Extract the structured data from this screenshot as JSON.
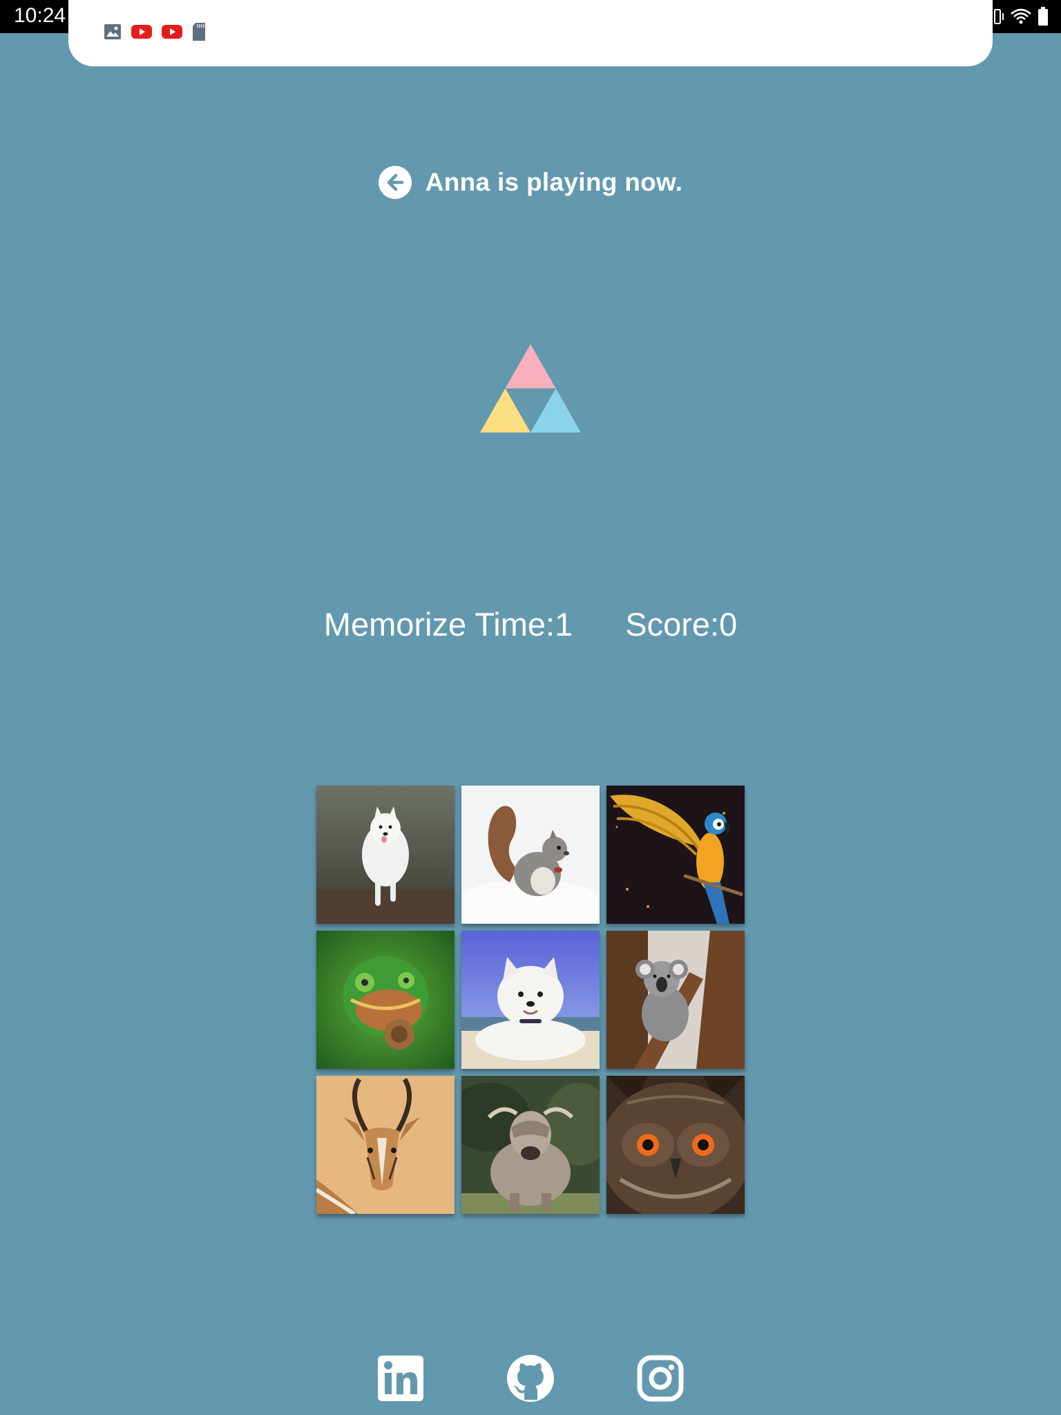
{
  "status_bar": {
    "time": "10:24",
    "icons": [
      "image-icon",
      "youtube-icon",
      "youtube-icon",
      "sd-card-icon",
      "vibrate-icon",
      "wifi-icon",
      "battery-icon"
    ]
  },
  "header": {
    "back_icon": "arrow-left-circle-icon",
    "title": "Anna is playing now."
  },
  "logo": {
    "colors": {
      "top": "#f7b0bc",
      "left": "#fbde82",
      "right": "#8bd3ea"
    }
  },
  "stats": {
    "memorize_label": "Memorize Time:",
    "memorize_value": "1",
    "score_label": "Score:",
    "score_value": "0"
  },
  "grid": {
    "tiles": [
      {
        "subject": "white dog running"
      },
      {
        "subject": "squirrel in snow"
      },
      {
        "subject": "macaw parrot"
      },
      {
        "subject": "chameleon"
      },
      {
        "subject": "white puppy on beach"
      },
      {
        "subject": "koala"
      },
      {
        "subject": "gazelle"
      },
      {
        "subject": "highland cow"
      },
      {
        "subject": "owl"
      }
    ]
  },
  "social": {
    "links": [
      "linkedin-icon",
      "github-icon",
      "instagram-icon"
    ]
  },
  "colors": {
    "background": "#6399ae",
    "text": "#ffffff"
  }
}
